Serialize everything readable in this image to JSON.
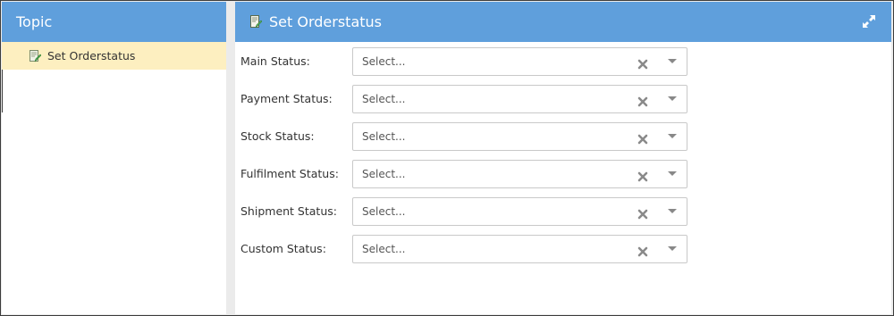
{
  "left_panel": {
    "title": "Topic",
    "items": [
      {
        "label": "Set Orderstatus",
        "icon": "document-edit-icon",
        "selected": true
      }
    ]
  },
  "main_panel": {
    "title": "Set Orderstatus",
    "title_icon": "document-edit-icon",
    "expand_icon": "expand-icon",
    "fields": [
      {
        "label": "Main Status:",
        "placeholder": "Select..."
      },
      {
        "label": "Payment Status:",
        "placeholder": "Select..."
      },
      {
        "label": "Stock Status:",
        "placeholder": "Select..."
      },
      {
        "label": "Fulfilment Status:",
        "placeholder": "Select..."
      },
      {
        "label": "Shipment Status:",
        "placeholder": "Select..."
      },
      {
        "label": "Custom Status:",
        "placeholder": "Select..."
      }
    ]
  },
  "colors": {
    "header_blue": "#5f9fdc",
    "selected_item": "#fdefc0",
    "gutter": "#ebebeb"
  }
}
